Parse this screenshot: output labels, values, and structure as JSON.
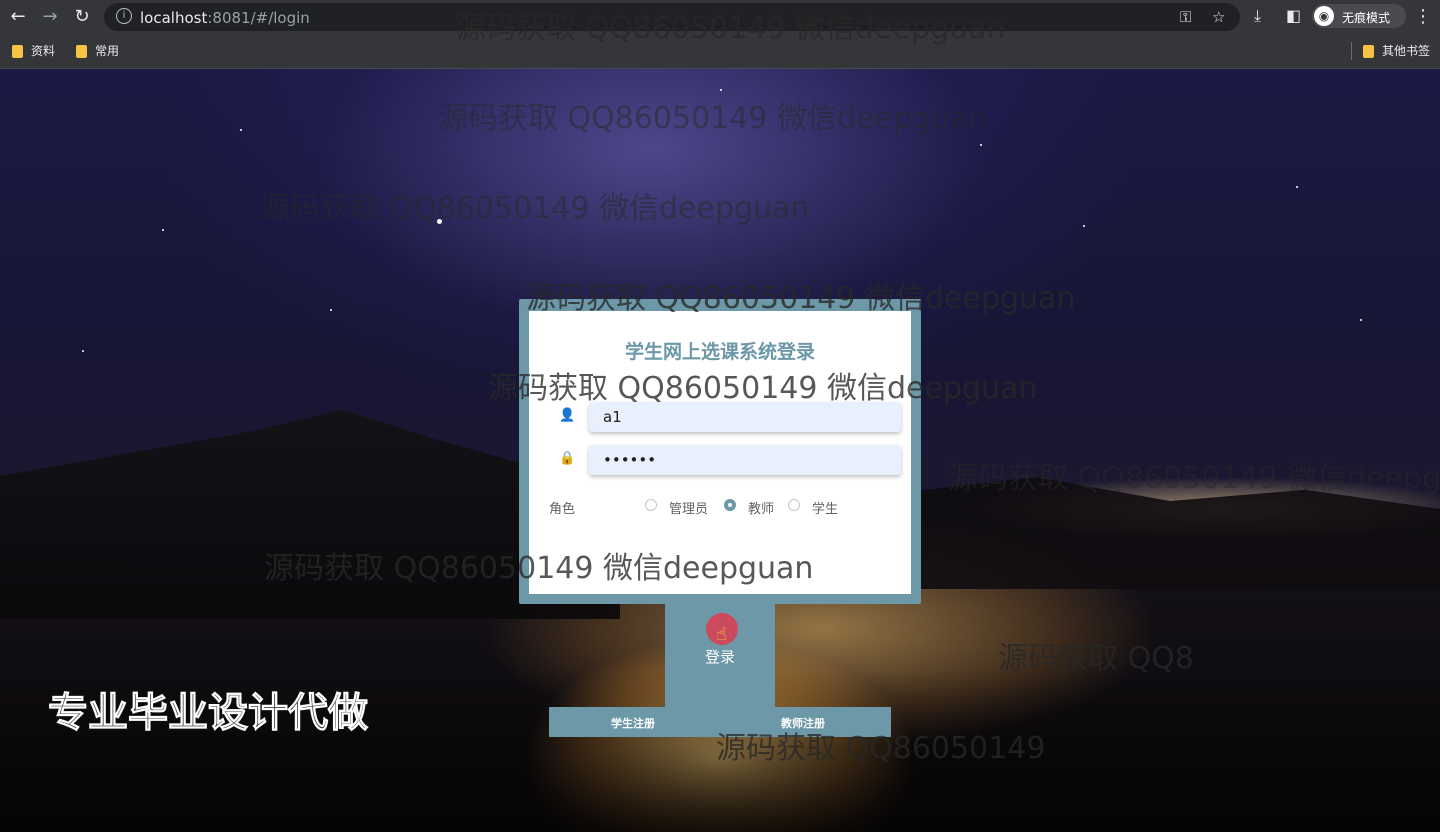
{
  "browser": {
    "url_host": "localhost",
    "url_rest": ":8081/#/login",
    "profile_label": "无痕模式",
    "bookmarks": [
      "资料",
      "常用"
    ],
    "other_bookmarks": "其他书签"
  },
  "form": {
    "title": "学生网上选课系统登录",
    "username_value": "a1",
    "password_value": "••••••",
    "role_label": "角色",
    "roles": [
      "管理员",
      "教师",
      "学生"
    ],
    "selected_role": "教师",
    "login_button": "登录",
    "student_register": "学生注册",
    "teacher_register": "教师注册"
  },
  "watermarks": {
    "text": "源码获取 QQ86050149 微信deepguan",
    "partial_1": "源码获取 QQ86050149 微信deepgu",
    "partial_2": "源码获取 QQ8",
    "partial_3": "源码获取 QQ86050149",
    "promo": "专业毕业设计代做"
  }
}
